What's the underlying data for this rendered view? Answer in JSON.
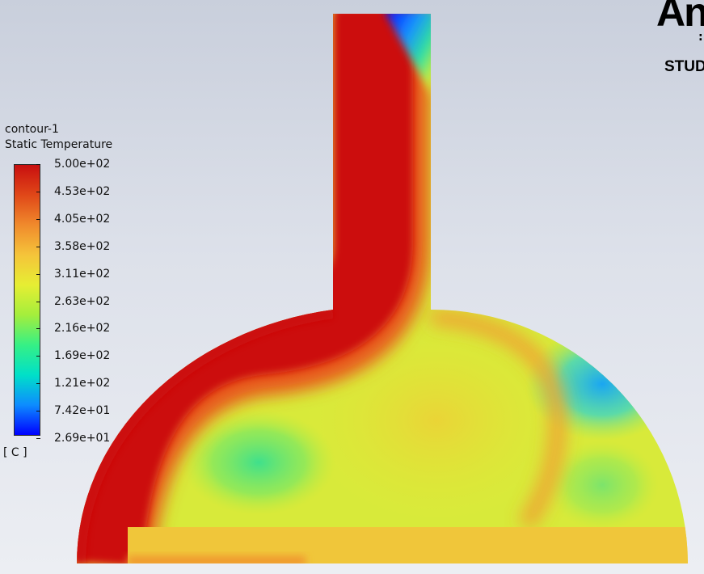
{
  "legend": {
    "name": "contour-1",
    "variable": "Static Temperature",
    "units": "[ C ]",
    "colormap": [
      "#0000ff",
      "#0d8cff",
      "#00e0c8",
      "#36f085",
      "#a4ee3c",
      "#e6ee33",
      "#f5c43a",
      "#f08a2c",
      "#e04718",
      "#c80f0f"
    ],
    "ticks": [
      "5.00e+02",
      "4.53e+02",
      "4.05e+02",
      "3.58e+02",
      "3.11e+02",
      "2.63e+02",
      "2.16e+02",
      "1.69e+02",
      "1.21e+02",
      "7.42e+01",
      "2.69e+01"
    ]
  },
  "branding": {
    "logo": "An",
    "edition": "STUD"
  },
  "field_colors": {
    "hot": "#cc0e0e",
    "hot_edge": "#e24a18",
    "warm": "#e6e83a",
    "mid": "#c8ec3a",
    "cool": "#4ce38a",
    "cold": "#2aa6f0",
    "min": "#0000ff",
    "floor": "#f2cc3c"
  }
}
